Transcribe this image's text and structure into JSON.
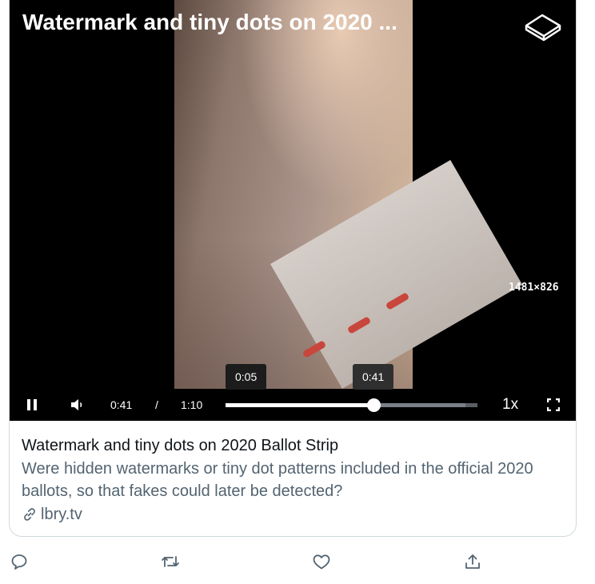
{
  "card": {
    "video": {
      "title": "Watermark and tiny dots on 2020 ...",
      "resolution": "1481×826",
      "hover_time": "0:05",
      "current_time_tooltip": "0:41",
      "logo_icon": "lbry-cube-icon"
    },
    "controls": {
      "pause_icon": "pause-icon",
      "volume_icon": "volume-icon",
      "current_time": "0:41",
      "separator": "/",
      "duration": "1:10",
      "playback_rate": "1x",
      "fullscreen_icon": "fullscreen-icon",
      "progress": {
        "played_fraction": 0.586,
        "buffered_fraction": 0.952,
        "hover_fraction": 0.076
      }
    },
    "title": "Watermark and tiny dots on 2020 Ballot Strip",
    "description_line1": "Were hidden watermarks or tiny dot patterns included in the official 2020",
    "description_line2": "ballots, so that fakes could later be detected?",
    "domain": "lbry.tv",
    "domain_icon": "link-icon"
  },
  "actions": [
    {
      "icon": "reply-icon"
    },
    {
      "icon": "retweet-icon"
    },
    {
      "icon": "like-icon"
    },
    {
      "icon": "share-icon"
    }
  ],
  "colors": {
    "player_background": "#000000",
    "secondary_text": "#536471",
    "primary_text": "#0f1419",
    "border": "#cfd9de"
  }
}
